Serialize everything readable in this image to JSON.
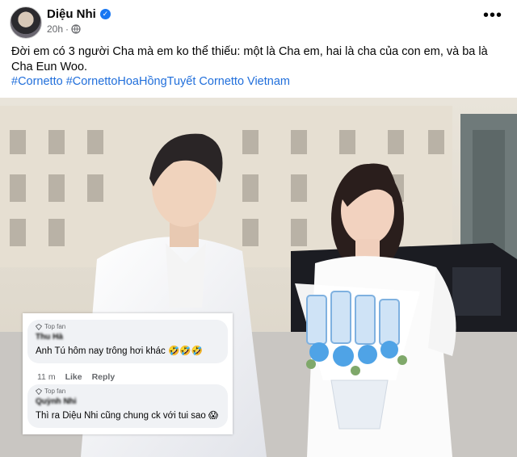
{
  "post": {
    "author": "Diệu Nhi",
    "time": "20h",
    "dot": "·",
    "more": "•••",
    "text": "Đời em có 3 người Cha mà em ko thể thiếu: một là Cha em, hai là cha của con em, và ba là Cha Eun Woo.",
    "hashtags": "#Cornetto #CornettoHoaHồngTuyết Cornetto Vietnam"
  },
  "comments": [
    {
      "badge": "Top fan",
      "name": "Thu Hà",
      "text": "Anh Tú hôm nay trông hơi khác 🤣🤣🤣",
      "time": "11 m",
      "like": "Like",
      "reply": "Reply"
    },
    {
      "badge": "Top fan",
      "name": "Quỳnh Nhi",
      "text": "Thì ra Diệu Nhi cũng chung ck với tui sao 😱"
    }
  ],
  "colors": {
    "link": "#216fdb",
    "verified": "#1877f2",
    "meta": "#65676b"
  }
}
